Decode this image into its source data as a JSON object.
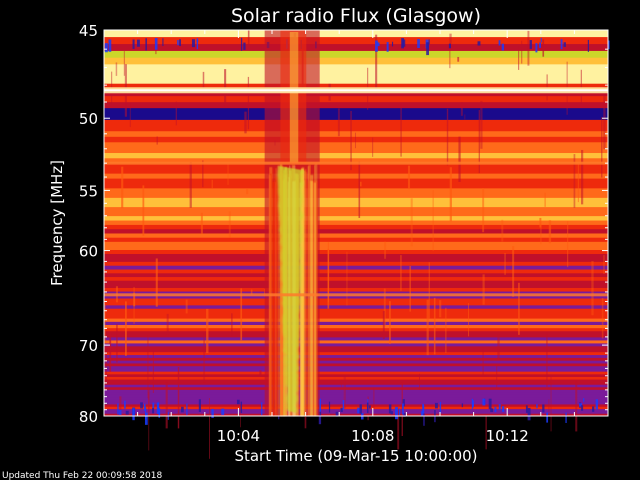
{
  "chart_data": {
    "type": "heatmap",
    "title": "Solar radio Flux (Glasgow)",
    "xlabel": "Start Time (09-Mar-15 10:00:00)",
    "ylabel": "Frequency [MHz]",
    "x_ticks": [
      {
        "value": 4,
        "label": "10:04"
      },
      {
        "value": 8,
        "label": "10:08"
      },
      {
        "value": 12,
        "label": "10:12"
      }
    ],
    "y_ticks": [
      {
        "value": 45,
        "label": "45"
      },
      {
        "value": 50,
        "label": "50"
      },
      {
        "value": 55,
        "label": "55"
      },
      {
        "value": 60,
        "label": "60"
      },
      {
        "value": 70,
        "label": "70"
      },
      {
        "value": 80,
        "label": "80"
      }
    ],
    "xlim_minutes": [
      0,
      15
    ],
    "ylim_mhz": [
      45,
      80
    ],
    "y_scale": "reciprocal",
    "colormap": [
      "#1a0a8c",
      "#3a1fc8",
      "#7a1b9a",
      "#c0102a",
      "#ee2a0c",
      "#ff6a1a",
      "#ffc03a",
      "#ccd62a",
      "#fff2a0"
    ],
    "features": [
      {
        "name": "burst",
        "start_minute": 4.9,
        "end_minute": 6.3
      },
      {
        "name": "interference",
        "mhz": 48.3
      },
      {
        "name": "interference",
        "mhz": 53.0
      },
      {
        "name": "interference",
        "mhz": 64.3
      }
    ]
  },
  "footer": {
    "updated_text": "Updated Thu Feb 22 00:09:58 2018"
  }
}
